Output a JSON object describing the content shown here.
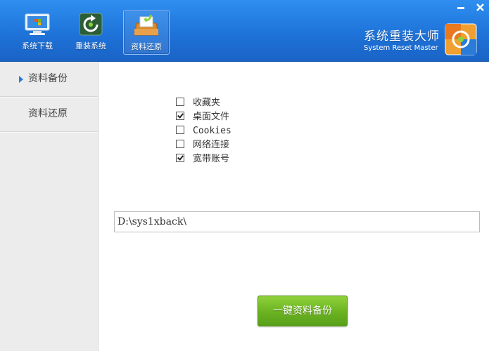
{
  "toolbar": {
    "items": [
      {
        "label": "系统下载",
        "icon": "monitor-icon"
      },
      {
        "label": "重装系统",
        "icon": "refresh-icon"
      },
      {
        "label": "资料还原",
        "icon": "inbox-icon",
        "active": true
      }
    ]
  },
  "window_controls": {
    "minimize": "minimize-icon",
    "close": "close-icon"
  },
  "brand": {
    "title": "系统重装大师",
    "subtitle": "System Reset Master"
  },
  "sidebar": {
    "items": [
      {
        "label": "资料备份",
        "active": true
      },
      {
        "label": "资料还原",
        "active": false
      }
    ]
  },
  "options": [
    {
      "label": "收藏夹",
      "checked": false
    },
    {
      "label": "桌面文件",
      "checked": true
    },
    {
      "label": "Cookies",
      "checked": false
    },
    {
      "label": "网络连接",
      "checked": false
    },
    {
      "label": "宽带账号",
      "checked": true
    }
  ],
  "path": {
    "value": "D:\\sys1xback\\"
  },
  "action_button": {
    "label": "一键资料备份"
  },
  "colors": {
    "titlebar": "#1e73d9",
    "button_green": "#6db523",
    "sidebar_bg": "#ececec"
  }
}
